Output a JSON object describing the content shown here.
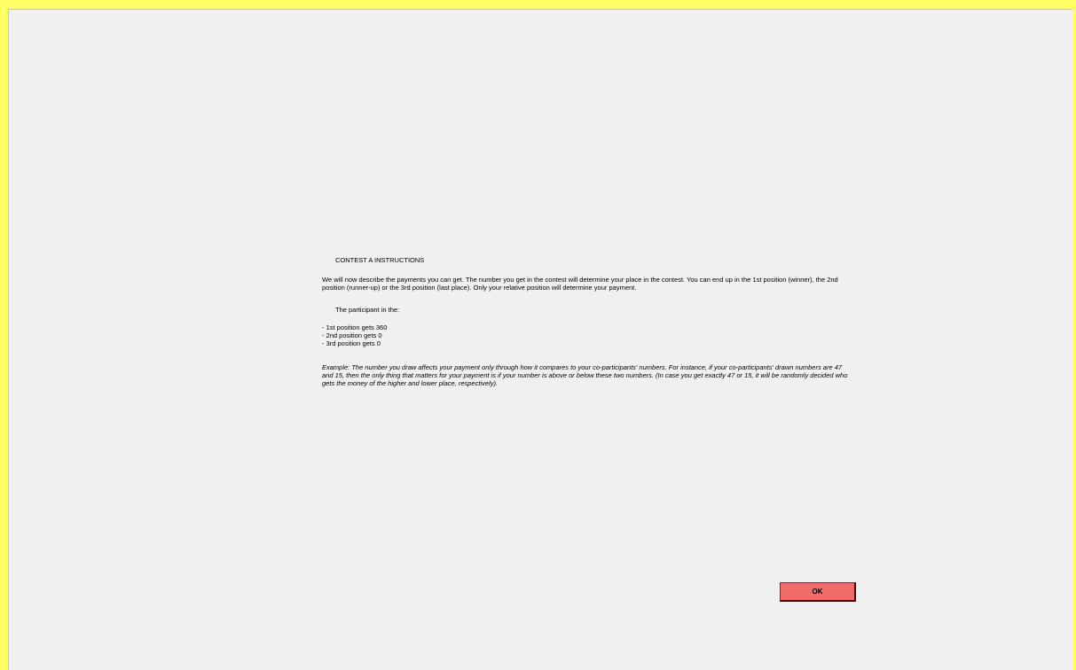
{
  "instructions": {
    "title": "CONTEST A  INSTRUCTIONS",
    "intro": "We will now describe the payments you can get. The number you get in the contest will determine your place in the contest. You can end up in the 1st position (winner), the 2nd position (runner-up) or the 3rd position (last place). Only your relative position will determine your payment.",
    "payment_heading": "The participant in the:",
    "payments": [
      "- 1st position gets 360",
      "- 2nd position gets 0",
      "- 3rd position gets 0"
    ],
    "example": "Example: The number you draw affects your payment only through how it compares to your co-participants' numbers. For instance, if your co-participants' drawn numbers are 47 and 15, then the only thing that matters for your payment is if your number is above or below these two numbers. (In case you get exactly 47 or 15, it will be randomly decided who gets the money of the higher and lower place, respectively)."
  },
  "ok_button": {
    "label": "OK"
  },
  "colors": {
    "border": "#ffff66",
    "background": "#f0f0f0",
    "ok_button": "#f26b6b"
  }
}
